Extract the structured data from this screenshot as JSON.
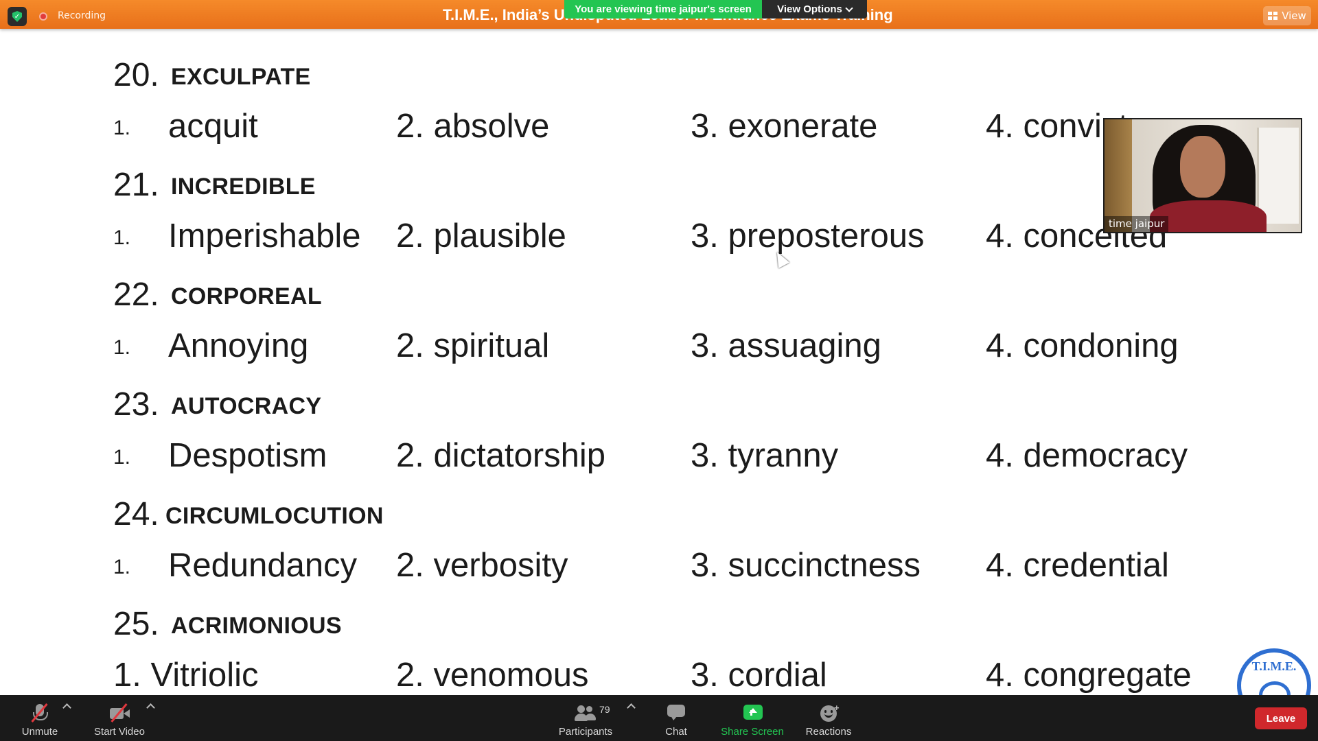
{
  "topbar": {
    "recording_label": "Recording",
    "title": "T.I.M.E., India’s Undisputed Leader in Entrance Exams Training",
    "viewing_banner": "You are viewing time jaipur's screen",
    "view_options_label": "View Options",
    "view_label": "View"
  },
  "slide": {
    "questions": [
      {
        "num": "20.",
        "word": "EXCULPATE",
        "options": [
          "1.",
          "acquit",
          "2. absolve",
          "3. exonerate",
          "4. convict"
        ]
      },
      {
        "num": "21.",
        "word": "INCREDIBLE",
        "options": [
          "1.",
          "Imperishable",
          "2. plausible",
          "3. preposterous",
          "4. conceited"
        ]
      },
      {
        "num": "22.",
        "word": "CORPOREAL",
        "options": [
          "1.",
          "Annoying",
          "2. spiritual",
          "3. assuaging",
          "4. condoning"
        ]
      },
      {
        "num": "23.",
        "word": "AUTOCRACY",
        "options": [
          "1.",
          "Despotism",
          "2. dictatorship",
          "3. tyranny",
          "4. democracy"
        ]
      },
      {
        "num": "24.",
        "word": "CIRCUMLOCUTION",
        "options": [
          "1.",
          "Redundancy",
          "2. verbosity",
          "3. succinctness",
          "4. credential"
        ]
      },
      {
        "num": "25.",
        "word": "ACRIMONIOUS",
        "options": [
          "1. Vitriolic",
          "2. venomous",
          "3. cordial",
          "4. congregate"
        ]
      }
    ],
    "logo_text": "T.I.M.E."
  },
  "video": {
    "participant_name": "time jaipur"
  },
  "toolbar": {
    "unmute_label": "Unmute",
    "start_video_label": "Start Video",
    "participants_label": "Participants",
    "participants_count": "79",
    "chat_label": "Chat",
    "share_screen_label": "Share Screen",
    "reactions_label": "Reactions",
    "leave_label": "Leave"
  },
  "colors": {
    "topbar": "#f07e22",
    "share_green": "#23c552",
    "leave_red": "#d0282c",
    "toolbar_bg": "#1a1a1a"
  }
}
